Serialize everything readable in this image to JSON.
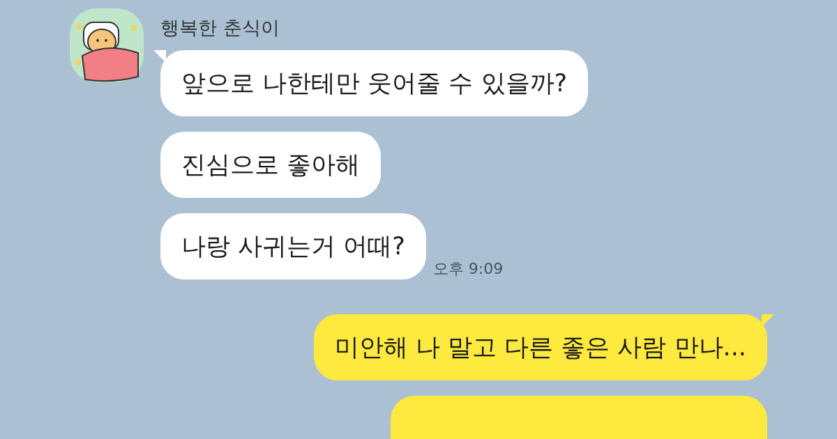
{
  "sender": {
    "name": "행복한 춘식이"
  },
  "messages": [
    {
      "kind": "incoming",
      "tail": true,
      "text": "앞으로 나한테만 웃어줄 수 있을까?"
    },
    {
      "kind": "incoming",
      "tail": false,
      "text": "진심으로 좋아해"
    },
    {
      "kind": "incoming",
      "tail": false,
      "text": "나랑 사귀는거 어때?",
      "time": "오후 9:09"
    },
    {
      "kind": "outgoing",
      "tail": true,
      "text": "미안해 나 말고 다른 좋은 사람 만나..."
    },
    {
      "kind": "outgoing",
      "tail": false
    }
  ]
}
